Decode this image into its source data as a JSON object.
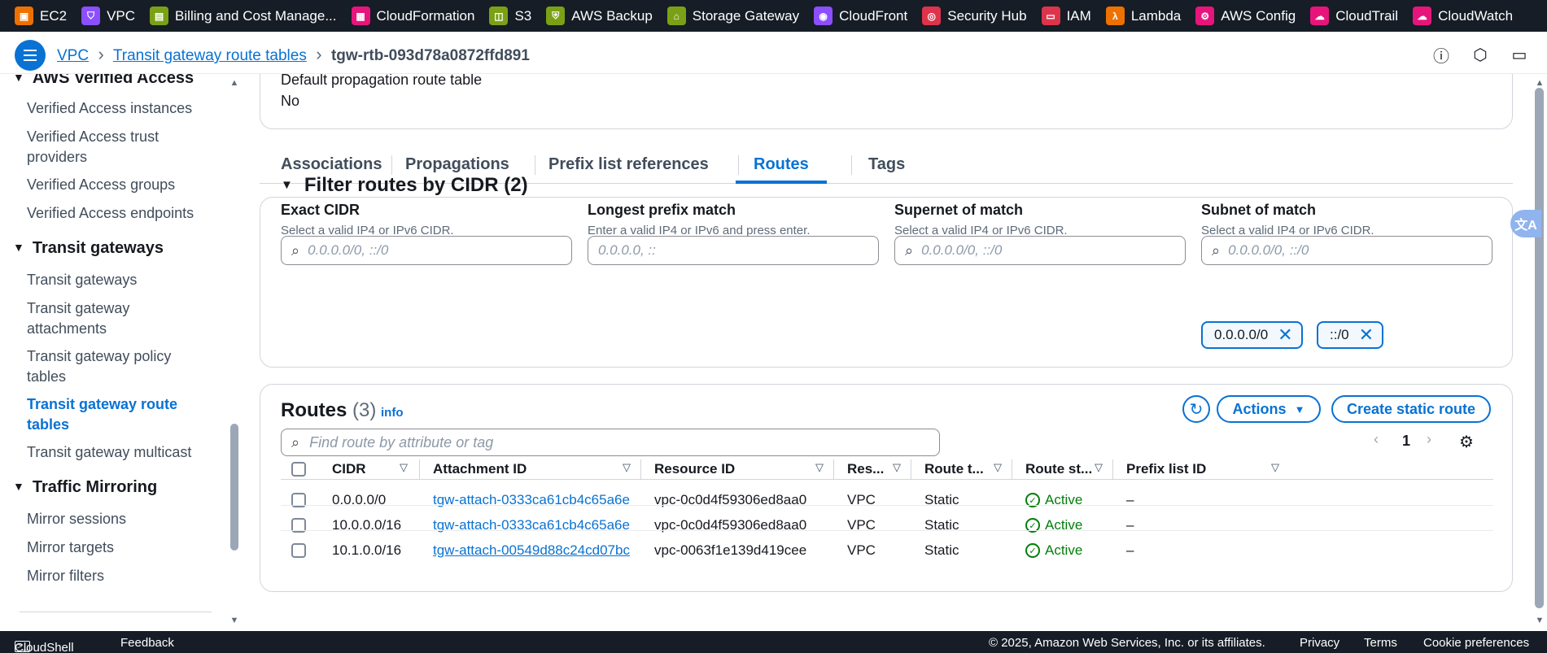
{
  "services": [
    {
      "label": "EC2",
      "color": "#ed7100",
      "icon": "ec2-icon"
    },
    {
      "label": "VPC",
      "color": "#8c4fff",
      "icon": "vpc-icon"
    },
    {
      "label": "Billing and Cost Manage...",
      "color": "#7aa116",
      "icon": "billing-icon"
    },
    {
      "label": "CloudFormation",
      "color": "#e7157b",
      "icon": "cloudformation-icon"
    },
    {
      "label": "S3",
      "color": "#7aa116",
      "icon": "s3-icon"
    },
    {
      "label": "AWS Backup",
      "color": "#7aa116",
      "icon": "backup-icon"
    },
    {
      "label": "Storage Gateway",
      "color": "#7aa116",
      "icon": "storage-gateway-icon"
    },
    {
      "label": "CloudFront",
      "color": "#8c4fff",
      "icon": "cloudfront-icon"
    },
    {
      "label": "Security Hub",
      "color": "#dd344c",
      "icon": "security-hub-icon"
    },
    {
      "label": "IAM",
      "color": "#dd344c",
      "icon": "iam-icon"
    },
    {
      "label": "Lambda",
      "color": "#ed7100",
      "icon": "lambda-icon"
    },
    {
      "label": "AWS Config",
      "color": "#e7157b",
      "icon": "config-icon"
    },
    {
      "label": "CloudTrail",
      "color": "#e7157b",
      "icon": "cloudtrail-icon"
    },
    {
      "label": "CloudWatch",
      "color": "#e7157b",
      "icon": "cloudwatch-icon"
    }
  ],
  "breadcrumb": {
    "vpc": "VPC",
    "route_tables": "Transit gateway route tables",
    "current": "tgw-rtb-093d78a0872ffd891"
  },
  "sidebar": {
    "sections": [
      {
        "title": "AWS Verified Access",
        "items": [
          "Verified Access instances",
          "Verified Access trust providers",
          "Verified Access groups",
          "Verified Access endpoints"
        ]
      },
      {
        "title": "Transit gateways",
        "items": [
          "Transit gateways",
          "Transit gateway attachments",
          "Transit gateway policy tables",
          "Transit gateway route tables",
          "Transit gateway multicast"
        ]
      },
      {
        "title": "Traffic Mirroring",
        "items": [
          "Mirror sessions",
          "Mirror targets",
          "Mirror filters"
        ]
      }
    ],
    "active_item": "Transit gateway route tables"
  },
  "details": {
    "label": "Default propagation route table",
    "value": "No"
  },
  "tabs": [
    "Associations",
    "Propagations",
    "Prefix list references",
    "Routes",
    "Tags"
  ],
  "active_tab": "Routes",
  "filter": {
    "title": "Filter routes by CIDR (2)",
    "fields": [
      {
        "label": "Exact CIDR",
        "desc": "Select a valid IP4 or IPv6 CIDR.",
        "placeholder": "0.0.0.0/0, ::/0",
        "has_search_icon": true
      },
      {
        "label": "Longest prefix match",
        "desc": "Enter a valid IP4 or IPv6 and press enter.",
        "placeholder": "0.0.0.0, ::",
        "has_search_icon": false
      },
      {
        "label": "Supernet of match",
        "desc": "Select a valid IP4 or IPv6 CIDR.",
        "placeholder": "0.0.0.0/0, ::/0",
        "has_search_icon": true
      },
      {
        "label": "Subnet of match",
        "desc": "Select a valid IP4 or IPv6 CIDR.",
        "placeholder": "0.0.0.0/0, ::/0",
        "has_search_icon": true
      }
    ],
    "tokens": [
      "0.0.0.0/0",
      "::/0"
    ]
  },
  "routes": {
    "title": "Routes",
    "count": "(3)",
    "info": "info",
    "actions_label": "Actions",
    "create_label": "Create static route",
    "search_placeholder": "Find route by attribute or tag",
    "page": "1",
    "columns": [
      "CIDR",
      "Attachment ID",
      "Resource ID",
      "Res...",
      "Route t...",
      "Route st...",
      "Prefix list ID"
    ],
    "rows": [
      {
        "cidr": "0.0.0.0/0",
        "attachment": "tgw-attach-0333ca61cb4c65a6e",
        "resource": "vpc-0c0d4f59306ed8aa0",
        "type": "VPC",
        "route_type": "Static",
        "state": "Active",
        "prefix": "–"
      },
      {
        "cidr": "10.0.0.0/16",
        "attachment": "tgw-attach-0333ca61cb4c65a6e",
        "resource": "vpc-0c0d4f59306ed8aa0",
        "type": "VPC",
        "route_type": "Static",
        "state": "Active",
        "prefix": "–"
      },
      {
        "cidr": "10.1.0.0/16",
        "attachment": "tgw-attach-00549d88c24cd07bc",
        "resource": "vpc-0063f1e139d419cee",
        "type": "VPC",
        "route_type": "Static",
        "state": "Active",
        "prefix": "–"
      }
    ]
  },
  "footer": {
    "cloudshell": "CloudShell",
    "feedback": "Feedback",
    "copyright": "© 2025, Amazon Web Services, Inc. or its affiliates.",
    "privacy": "Privacy",
    "terms": "Terms",
    "cookies": "Cookie preferences"
  },
  "translate_label": "文A"
}
